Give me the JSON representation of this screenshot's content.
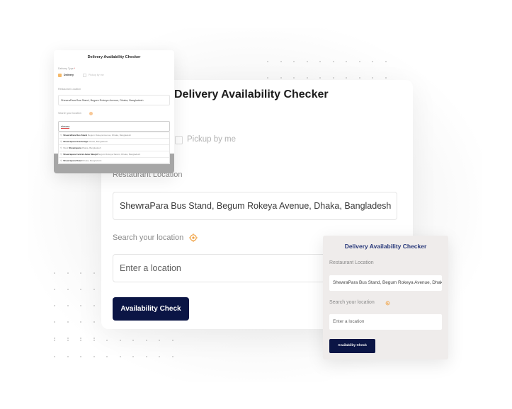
{
  "main_card": {
    "title": "Delivery Availability Checker",
    "pickup_label": "Pickup by me",
    "restaurant_location_label": "Restaurant Location",
    "restaurant_location_value": "ShewraPara Bus Stand, Begum Rokeya Avenue, Dhaka, Bangladesh",
    "search_label": "Search your location",
    "search_placeholder": "Enter a location",
    "check_button": "Availability Check"
  },
  "top_left_card": {
    "title": "Delivery Availability Checker",
    "delivery_type_label": "Delivery Type",
    "required_mark": "*",
    "option_delivery": "Delivery",
    "option_pickup": "Pickup by me",
    "restaurant_location_label": "Restaurant Location",
    "restaurant_location_value": "ShewraPara Bus Stand, Begum Rokeya Avenue, Dhaka, Bangladesh",
    "search_label": "Search your location",
    "search_value": "shewra",
    "suggestions": [
      {
        "match": "ShewraPara Bus Stand",
        "detail": "Begum Rokeya Avenue, Dhaka, Bangladesh",
        "prefix": ""
      },
      {
        "match": "Shewrapara Overbridge",
        "detail": "Dhaka, Bangladesh",
        "prefix": ""
      },
      {
        "match": "Shewrapara",
        "detail": "Dhaka, Bangladesh",
        "prefix": "West "
      },
      {
        "match": "Shewrapara Central Jame Masjid",
        "detail": "Begum Rokeya Sarani, Dhaka, Bangladesh",
        "prefix": ""
      },
      {
        "match": "Shewrapara Road",
        "detail": "Dhaka, Bangladesh",
        "prefix": ""
      }
    ]
  },
  "bottom_right_card": {
    "title": "Delivery Availability Checker",
    "restaurant_location_label": "Restaurant Location",
    "restaurant_location_value": "ShewraPara Bus Stand, Begum Rokeya Avenue, Dhaka, Bangladesh",
    "search_label": "Search your location",
    "search_placeholder": "Enter a location",
    "check_button": "Availability Check"
  },
  "colors": {
    "button_bg": "#0b1545",
    "accent_orange": "#f0a040",
    "title_blue": "#28387a"
  }
}
